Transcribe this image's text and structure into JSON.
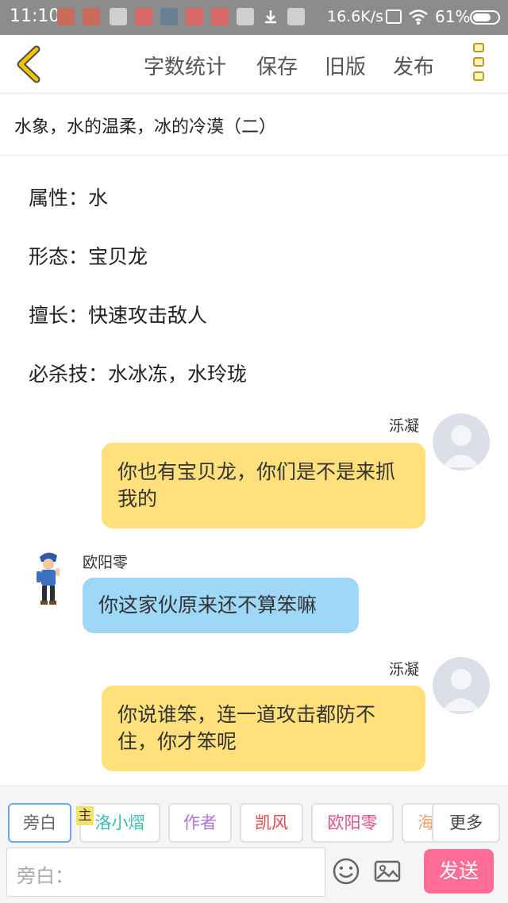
{
  "status_bar": {
    "time": "11:10",
    "network_speed": "16.6K/s",
    "battery": "61%",
    "icons": [
      "mi-icon",
      "mi-icon",
      "video-icon",
      "app-icon",
      "gallery-icon",
      "app-icon",
      "video-icon",
      "download-icon",
      "mi-icon",
      "sim-icon",
      "wifi-icon",
      "battery-icon"
    ]
  },
  "toolbar": {
    "back_icon": "back-chevron-icon",
    "buttons": [
      "字数统计",
      "保存",
      "旧版",
      "发布"
    ],
    "more_icon": "more-vertical-icon",
    "accent_color": "#f2c400"
  },
  "document": {
    "title": "水象，水的温柔，冰的冷漠（二）"
  },
  "properties": [
    "属性：水",
    "形态：宝贝龙",
    "擅长：快速攻击敌人",
    "必杀技：水冰冻，水玲珑"
  ],
  "messages": [
    {
      "side": "right",
      "name": "泺凝",
      "text": "你也有宝贝龙，你们是不是来抓我的",
      "color": "#ffe07a"
    },
    {
      "side": "left",
      "name": "欧阳零",
      "text": "你这家伙原来还不算笨嘛",
      "color": "#9fd8f7"
    },
    {
      "side": "right",
      "name": "泺凝",
      "text": "你说谁笨，连一道攻击都防不住，你才笨呢",
      "color": "#ffe07a"
    }
  ],
  "roles": {
    "chips": [
      {
        "label": "旁白",
        "color": "#666666"
      },
      {
        "label": "洛小熠",
        "color": "#3bbfb0"
      },
      {
        "label": "作者",
        "color": "#b074d6"
      },
      {
        "label": "凯风",
        "color": "#e04a4a"
      },
      {
        "label": "欧阳零",
        "color": "#e0508f"
      },
      {
        "label": "海",
        "color": "#f2a06b"
      }
    ],
    "main_tag": "主",
    "more_label": "更多"
  },
  "input": {
    "placeholder": "旁白：",
    "emoji_icon": "emoji-icon",
    "image_icon": "image-icon",
    "send_label": "发送",
    "send_color": "#ff6c96"
  }
}
